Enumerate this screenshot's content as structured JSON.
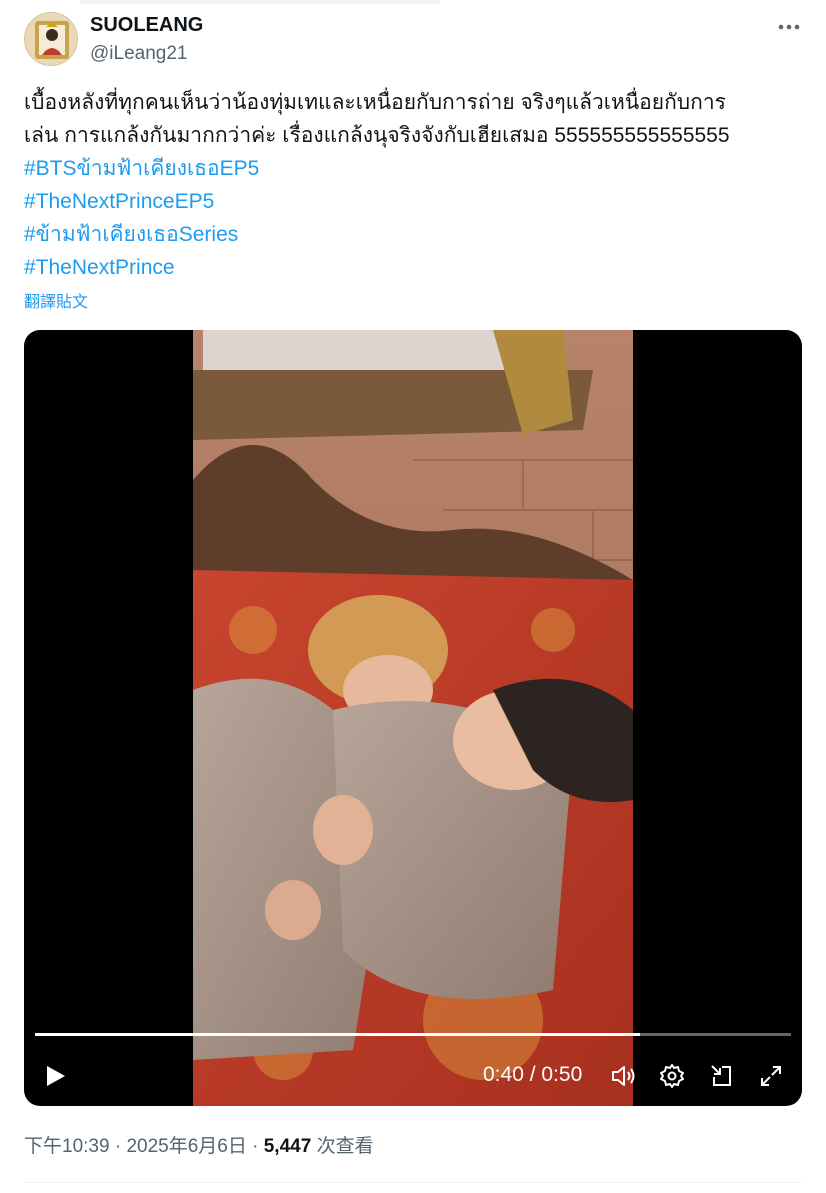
{
  "author": {
    "name": "SUOLEANG",
    "handle": "@iLeang21",
    "avatar_icon": "royal-portrait-avatar"
  },
  "more_icon": "more-dots-icon",
  "post": {
    "line1": "เบื้องหลังที่ทุกคนเห็นว่าน้องทุ่มเทและเหนื่อยกับการถ่าย จริงๆแล้วเหนื่อยกับการ",
    "line2": "เล่น การแกล้งกันมากกว่าค่ะ เรื่องแกล้งนุจริงจังกับเฮียเสมอ 555555555555555",
    "hashtags": [
      "#BTSข้ามฟ้าเคียงเธอEP5",
      "#TheNextPrinceEP5",
      "#ข้ามฟ้าเคียงเธอSeries",
      "#TheNextPrince"
    ],
    "translate_label": "翻譯貼文"
  },
  "video": {
    "current_time": "0:40",
    "duration": "0:50",
    "time_display": "0:40 / 0:50",
    "progress": 0.8,
    "controls": [
      "play-icon",
      "volume-icon",
      "settings-icon",
      "pip-icon",
      "fullscreen-icon"
    ]
  },
  "meta": {
    "time": "下午10:39",
    "date": "2025年6月6日",
    "separator": " · ",
    "views_count": "5,447",
    "views_label": "次查看"
  },
  "colors": {
    "link": "#1d9bf0",
    "text": "#0f1419",
    "muted": "#536471"
  }
}
